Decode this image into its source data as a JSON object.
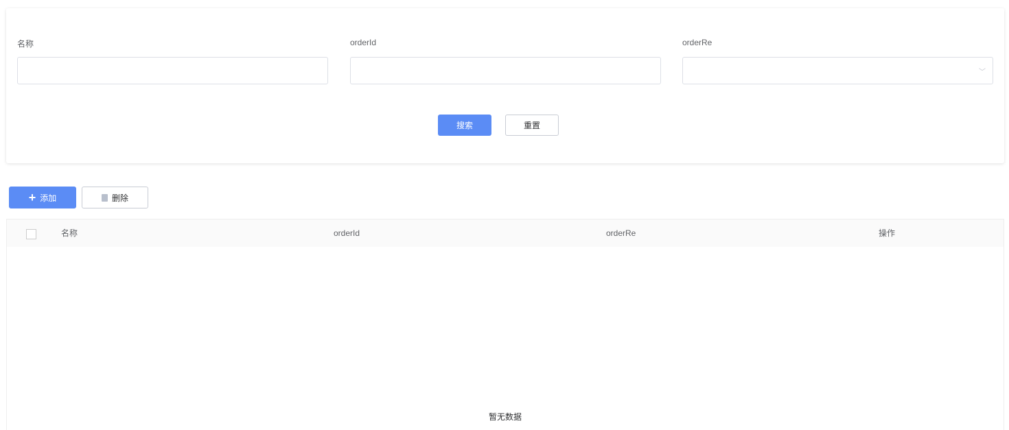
{
  "search_form": {
    "fields": [
      {
        "label": "名称",
        "value": ""
      },
      {
        "label": "orderId",
        "value": ""
      },
      {
        "label": "orderRe",
        "value": ""
      }
    ],
    "search_label": "搜索",
    "reset_label": "重置"
  },
  "toolbar": {
    "add_label": "添加",
    "delete_label": "删除"
  },
  "table": {
    "columns": [
      "名称",
      "orderId",
      "orderRe",
      "操作"
    ],
    "rows": [],
    "empty_text": "暂无数据"
  },
  "colors": {
    "primary": "#5b8cf5"
  }
}
